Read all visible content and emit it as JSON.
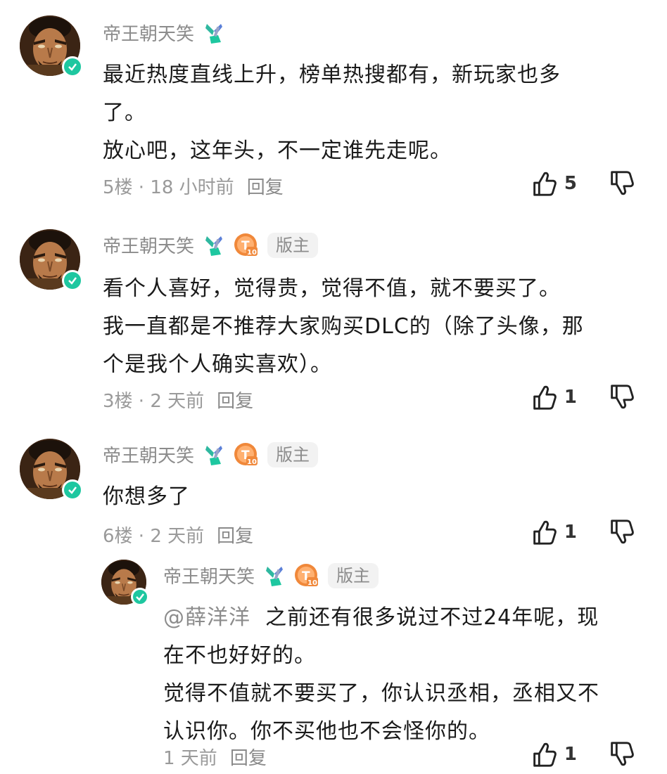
{
  "comments": [
    {
      "username": "帝王朝天笑",
      "is_moderator": false,
      "lines": [
        "最近热度直线上升，榜单热搜都有，新玩家也多",
        "了。",
        "放心吧，这年头，不一定谁先走呢。"
      ],
      "floor_time": "5楼 · 18 小时前",
      "reply_label": "回复",
      "likes": "5"
    },
    {
      "username": "帝王朝天笑",
      "is_moderator": true,
      "level_badge": "T10",
      "mod_label": "版主",
      "lines": [
        "看个人喜好，觉得贵，觉得不值，就不要买了。",
        "我一直都是不推荐大家购买DLC的（除了头像，那",
        "个是我个人确实喜欢）。"
      ],
      "floor_time": "3楼 · 2 天前",
      "reply_label": "回复",
      "likes": "1"
    },
    {
      "username": "帝王朝天笑",
      "is_moderator": true,
      "level_badge": "T10",
      "mod_label": "版主",
      "lines": [
        "你想多了"
      ],
      "floor_time": "6楼 · 2 天前",
      "reply_label": "回复",
      "likes": "1"
    },
    {
      "username": "帝王朝天笑",
      "is_moderator": true,
      "level_badge": "T10",
      "mod_label": "版主",
      "mention": "@薛洋洋",
      "lines": [
        "之前还有很多说过不过24年呢，现",
        "在不也好好的。",
        "觉得不值就不要买了，你认识丞相，丞相又不",
        "认识你。你不买他也不会怪你的。"
      ],
      "floor_time": "1 天前",
      "reply_label": "回复",
      "likes": "1"
    }
  ],
  "colors": {
    "verified": "#1ec7a0",
    "level_badge": "#f0883a",
    "muted_text": "#8c8c8c"
  },
  "icons": {
    "verified": "check-icon",
    "pendant": "game-pendant-icon",
    "like": "thumbs-up-icon",
    "dislike": "thumbs-down-icon"
  }
}
